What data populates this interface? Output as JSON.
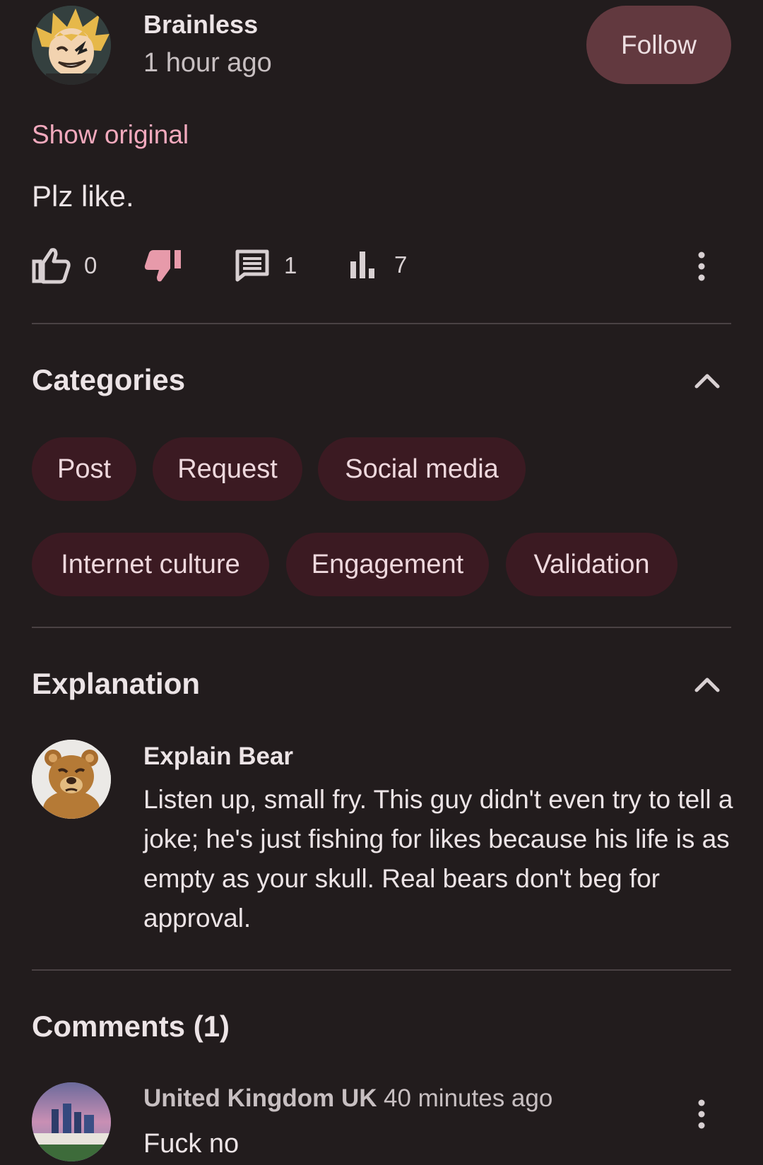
{
  "post": {
    "author": "Brainless",
    "time": "1 hour ago",
    "follow_label": "Follow",
    "show_original": "Show original",
    "body": "Plz like."
  },
  "actions": {
    "likes": "0",
    "comments": "1",
    "views": "7",
    "like_icon": "thumbs-up-icon",
    "dislike_icon": "thumbs-down-icon",
    "comment_icon": "comment-icon",
    "stats_icon": "bar-chart-icon",
    "more_icon": "more-vertical-icon"
  },
  "categories": {
    "title": "Categories",
    "items": [
      "Post",
      "Request",
      "Social media",
      "Internet culture",
      "Engagement",
      "Validation"
    ]
  },
  "explanation": {
    "title": "Explanation",
    "author": "Explain Bear",
    "text": "Listen up, small fry. This guy didn't even try to tell a joke; he's just fishing for likes because his life is as empty as your skull. Real bears don't beg for approval."
  },
  "comments": {
    "title": "Comments (1)",
    "items": [
      {
        "author": "United Kingdom UK",
        "time": "40 minutes ago",
        "text": "Fuck no"
      }
    ]
  },
  "colors": {
    "background": "#221c1d",
    "accent_pink": "#f2a9bd",
    "follow_button": "#62393f",
    "chip_background": "#3b1a22",
    "dislike_active": "#e79aaa"
  }
}
